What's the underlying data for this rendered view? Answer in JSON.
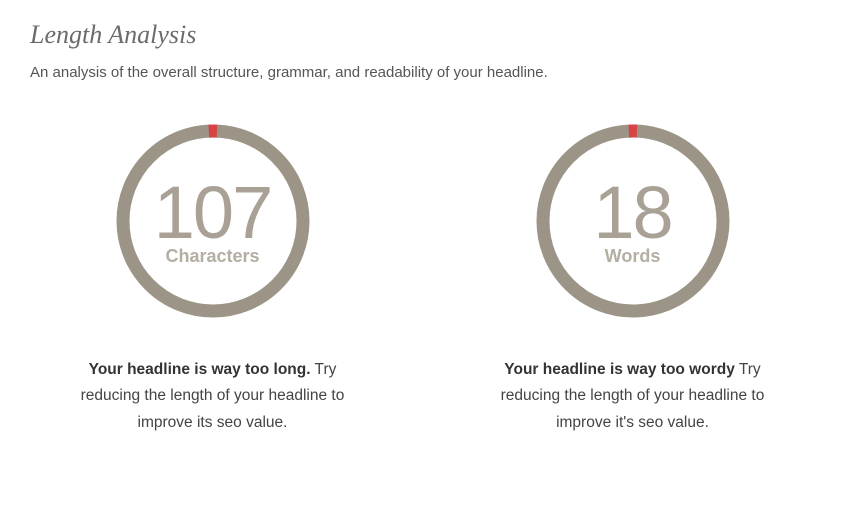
{
  "section": {
    "title": "Length Analysis",
    "description": "An analysis of the overall structure, grammar, and readability of your headline."
  },
  "metrics": [
    {
      "value": "107",
      "label": "Characters",
      "message_bold": "Your headline is way too long.",
      "message_rest": " Try reducing the length of your headline to improve its seo value."
    },
    {
      "value": "18",
      "label": "Words",
      "message_bold": "Your headline is way too wordy",
      "message_rest": " Try reducing the length of your headline to improve it's seo value."
    }
  ],
  "colors": {
    "ring": "#9c9587",
    "indicator": "#d84343"
  }
}
